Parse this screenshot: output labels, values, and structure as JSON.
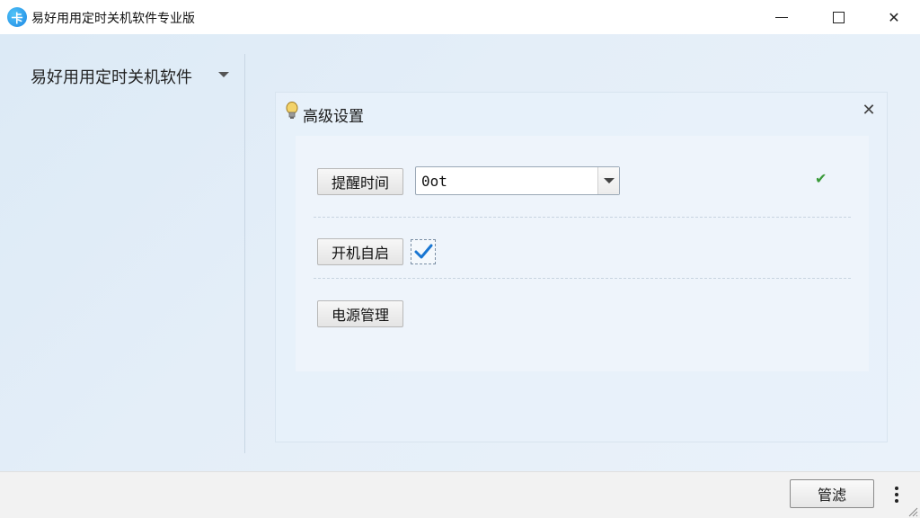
{
  "window": {
    "title": "易好用用定时关机软件专业版",
    "logo_text": "卡",
    "minimize": "minimize",
    "maximize": "maximize",
    "close_glyph": "✕"
  },
  "sidebar": {
    "app_name": "易好用用定时关机软件"
  },
  "panel": {
    "title": "高级设置",
    "close_glyph": "✕",
    "reminder_label": "提醒时间",
    "reminder_value": "0ot",
    "reminder_status_glyph": "✔",
    "autostart_label": "开机自启",
    "autostart_checked": true,
    "power_label": "电源管理"
  },
  "footer": {
    "filter_label": "管滤"
  },
  "colors": {
    "accent": "#1e88e5",
    "check": "#3a9a3a",
    "checkbox_tick": "#1976d2"
  }
}
